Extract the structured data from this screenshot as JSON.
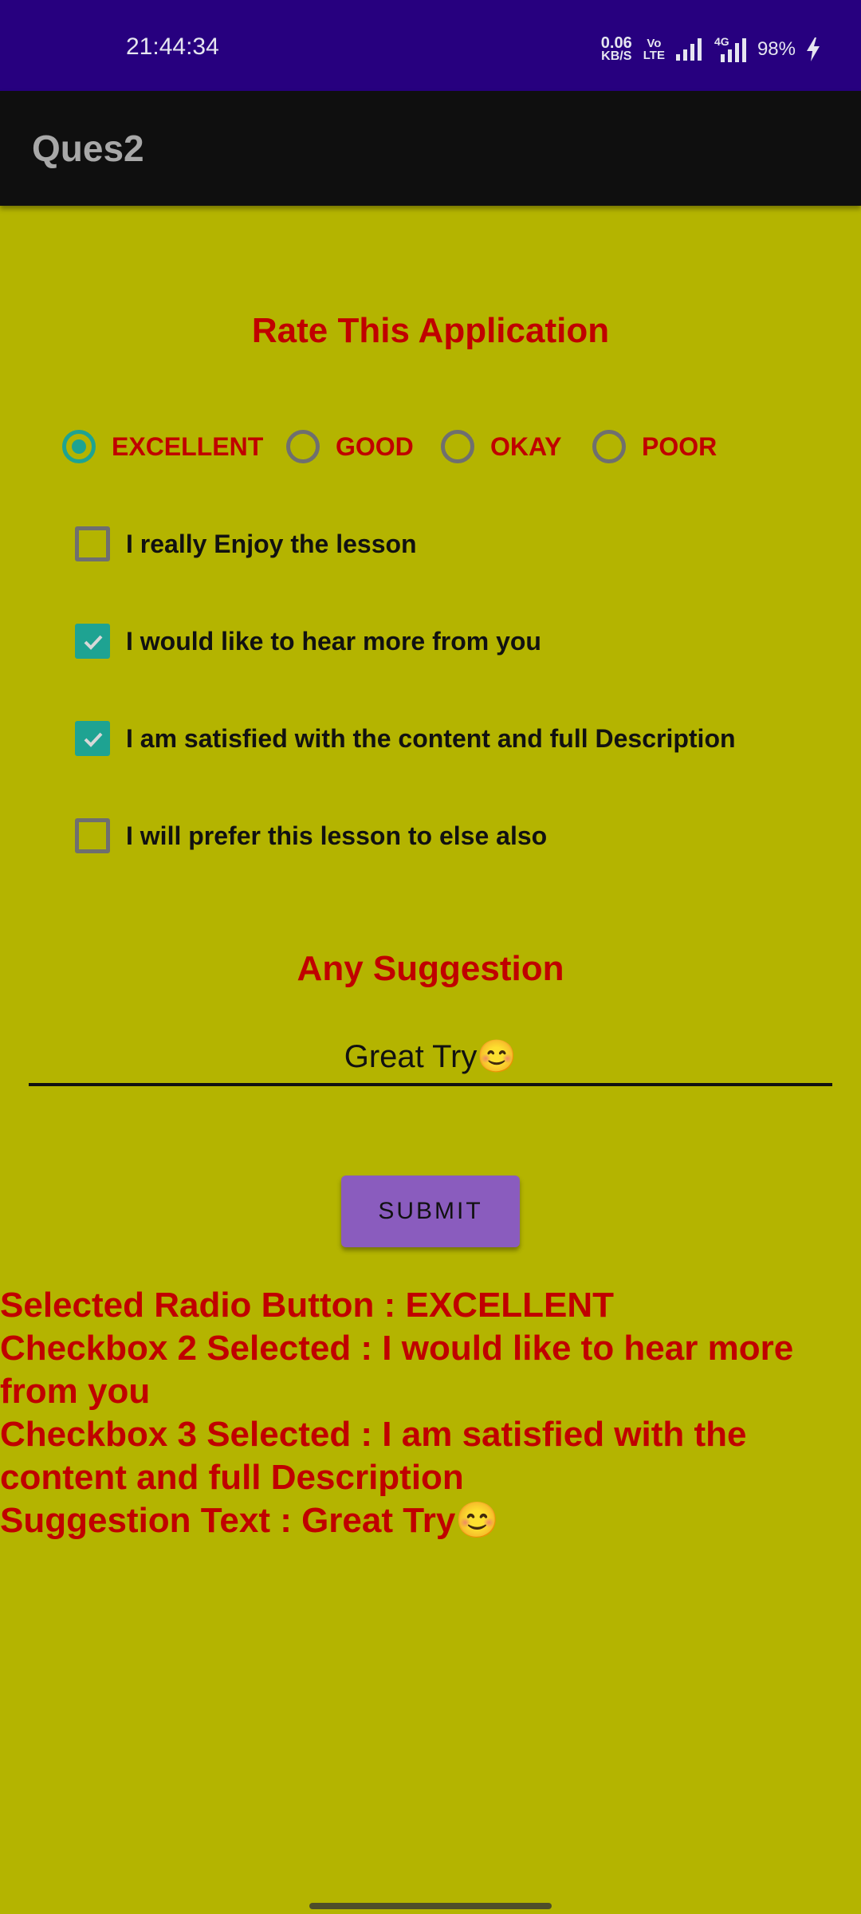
{
  "status_bar": {
    "time": "21:44:34",
    "net_speed_value": "0.06",
    "net_speed_unit": "KB/S",
    "volte_top": "Vo",
    "volte_bottom": "LTE",
    "network_type": "4G",
    "battery": "98%"
  },
  "app_bar": {
    "title": "Ques2"
  },
  "form": {
    "heading": "Rate This Application",
    "radios": [
      {
        "label": "EXCELLENT",
        "checked": true
      },
      {
        "label": "GOOD",
        "checked": false
      },
      {
        "label": "OKAY",
        "checked": false
      },
      {
        "label": "POOR",
        "checked": false
      }
    ],
    "checkboxes": [
      {
        "label": "I really Enjoy the lesson",
        "checked": false
      },
      {
        "label": "I would like to hear more from you",
        "checked": true
      },
      {
        "label": "I am satisfied with the content and full Description",
        "checked": true
      },
      {
        "label": "I will prefer this lesson to else also",
        "checked": false
      }
    ],
    "suggestion_heading": "Any Suggestion",
    "suggestion_value": "Great Try😊",
    "submit_label": "SUBMIT"
  },
  "result": {
    "lines": [
      "Selected Radio Button : EXCELLENT",
      "Checkbox 2 Selected : I would like to hear more from you",
      "Checkbox 3 Selected : I am satisfied with the content and full Description",
      "Suggestion Text : Great Try😊"
    ]
  },
  "colors": {
    "background": "#b4b400",
    "status_bar": "#27007f",
    "app_bar": "#0f0f0f",
    "accent_teal": "#1ea392",
    "text_red": "#c00000",
    "button_purple": "#8a5cbe"
  }
}
